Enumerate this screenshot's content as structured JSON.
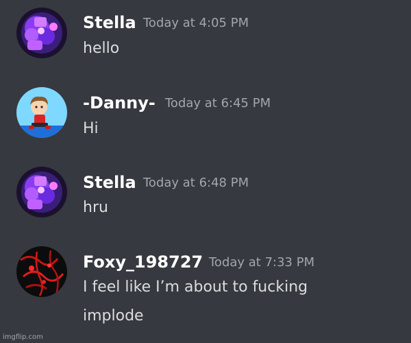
{
  "messages": [
    {
      "author": "Stella",
      "timestamp": "Today at 4:05 PM",
      "lines": [
        "hello"
      ],
      "avatar_icon": "purple-robot-avatar-icon",
      "name_color": "#ffffff"
    },
    {
      "author": "-Danny-",
      "timestamp": "Today at 6:45 PM",
      "lines": [
        "Hi"
      ],
      "avatar_icon": "cartoon-boy-avatar-icon",
      "name_color": "#ffffff"
    },
    {
      "author": "Stella",
      "timestamp": "Today at 6:48 PM",
      "lines": [
        "hru"
      ],
      "avatar_icon": "purple-robot-avatar-icon",
      "name_color": "#ffffff"
    },
    {
      "author": "Foxy_198727",
      "timestamp": "Today at 7:33 PM",
      "lines": [
        "I feel like I’m about to fucking",
        "implode"
      ],
      "avatar_icon": "red-dark-avatar-icon",
      "name_color": "#ffffff"
    }
  ],
  "watermark": "imgflip.com",
  "colors": {
    "background": "#36393f",
    "message_text": "#dcddde",
    "timestamp": "#a3a6aa"
  }
}
